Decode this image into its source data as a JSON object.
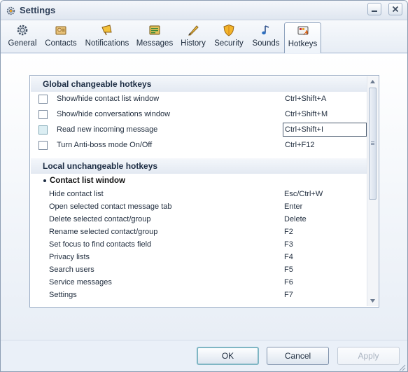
{
  "window": {
    "title": "Settings"
  },
  "tabs": [
    {
      "label": "General",
      "icon": "gear-icon"
    },
    {
      "label": "Contacts",
      "icon": "contact-card-icon"
    },
    {
      "label": "Notifications",
      "icon": "megaphone-icon"
    },
    {
      "label": "Messages",
      "icon": "messages-icon"
    },
    {
      "label": "History",
      "icon": "quill-icon"
    },
    {
      "label": "Security",
      "icon": "shield-icon"
    },
    {
      "label": "Sounds",
      "icon": "music-note-icon"
    },
    {
      "label": "Hotkeys",
      "icon": "hotkeys-icon"
    }
  ],
  "active_tab": "Hotkeys",
  "global": {
    "header": "Global changeable hotkeys",
    "rows": [
      {
        "label": "Show/hide contact list window",
        "key": "Ctrl+Shift+A",
        "checked": false
      },
      {
        "label": "Show/hide conversations window",
        "key": "Ctrl+Shift+M",
        "checked": false
      },
      {
        "label": "Read new incoming message",
        "key": "Ctrl+Shift+I",
        "checked": false
      },
      {
        "label": "Turn Anti-boss mode On/Off",
        "key": "Ctrl+F12",
        "checked": false
      }
    ]
  },
  "local": {
    "header": "Local unchangeable hotkeys",
    "group": "Contact list window",
    "rows": [
      {
        "label": "Hide contact list",
        "key": "Esc/Ctrl+W"
      },
      {
        "label": "Open selected contact message tab",
        "key": "Enter"
      },
      {
        "label": "Delete selected contact/group",
        "key": "Delete"
      },
      {
        "label": "Rename selected contact/group",
        "key": "F2"
      },
      {
        "label": "Set focus to find contacts field",
        "key": "F3"
      },
      {
        "label": "Privacy lists",
        "key": "F4"
      },
      {
        "label": "Search users",
        "key": "F5"
      },
      {
        "label": "Service messages",
        "key": "F6"
      },
      {
        "label": "Settings",
        "key": "F7"
      }
    ]
  },
  "footer": {
    "ok_label": "OK",
    "cancel_label": "Cancel",
    "apply_label": "Apply"
  }
}
